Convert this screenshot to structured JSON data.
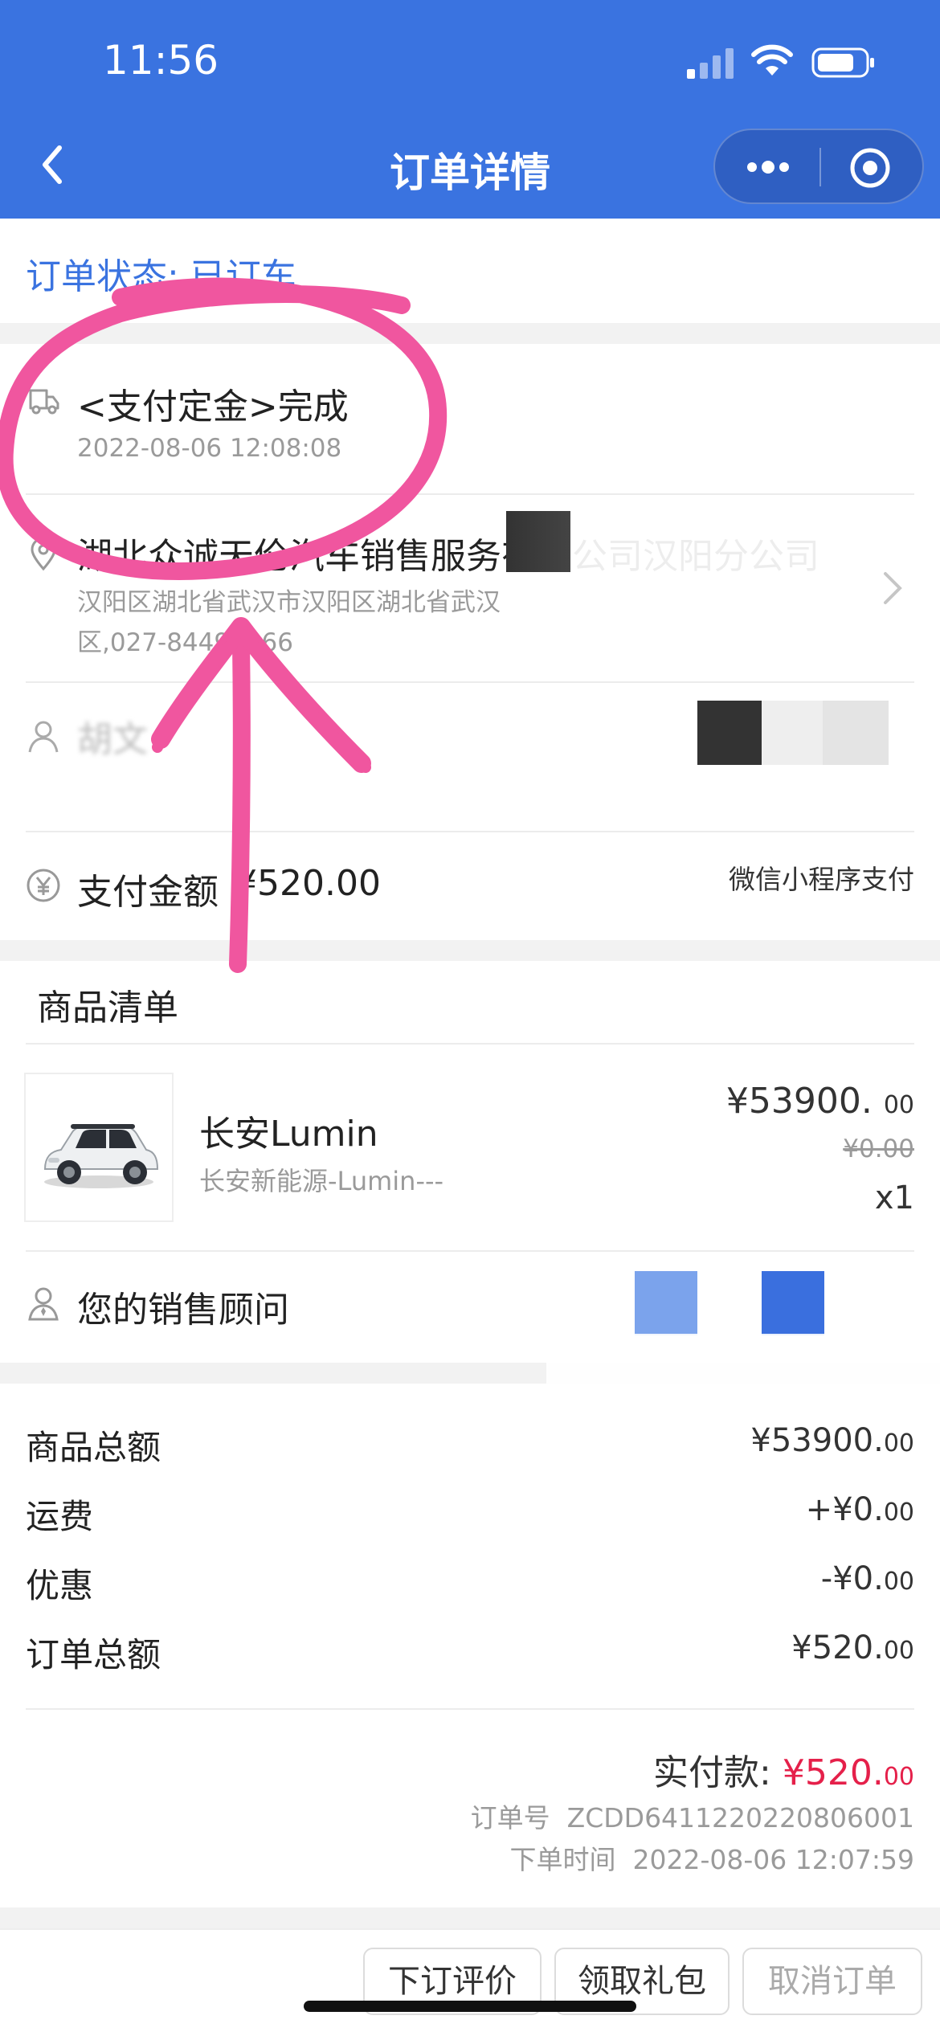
{
  "status_bar": {
    "time": "11:56"
  },
  "nav": {
    "title": "订单详情"
  },
  "order_status": "订单状态: 已订车",
  "progress": {
    "step": "<支付定金>完成",
    "time": "2022-08-06 12:08:08"
  },
  "dealer": {
    "name": "湖北众诚天伦汽车销售服务有限公司汉阳分公司",
    "address_line1": "汉阳区湖北省武汉市汉阳区湖北省武汉",
    "address_line2": "区,027-84498866"
  },
  "customer": {
    "name": "胡文"
  },
  "payment": {
    "label": "支付金额",
    "amount": "¥520.00",
    "method": "微信小程序支付"
  },
  "product_list": {
    "title": "商品清单",
    "item": {
      "name": "长安Lumin",
      "subtitle": "长安新能源-Lumin---",
      "price_main": "¥53900.",
      "price_cents": "00",
      "original_price": "¥0.00",
      "qty": "x1"
    }
  },
  "advisor": {
    "label": "您的销售顾问"
  },
  "summary": {
    "rows": [
      {
        "label": "商品总额",
        "value_main": "¥53900.",
        "value_cents": "00"
      },
      {
        "label": "运费",
        "value_main": "+¥0.",
        "value_cents": "00"
      },
      {
        "label": "优惠",
        "value_main": "-¥0.",
        "value_cents": "00"
      },
      {
        "label": "订单总额",
        "value_main": "¥520.",
        "value_cents": "00"
      }
    ],
    "paid_label": "实付款:",
    "paid_main": "¥520.",
    "paid_cents": "00",
    "order_no_label": "订单号",
    "order_no": "ZCDD6411220220806001",
    "order_time_label": "下单时间",
    "order_time": "2022-08-06 12:07:59"
  },
  "actions": {
    "review": "下订评价",
    "gift": "领取礼包",
    "cancel": "取消订单"
  },
  "colors": {
    "primary": "#3a73e0",
    "accent_red": "#e5204a",
    "annotation_pink": "#f0569f"
  }
}
